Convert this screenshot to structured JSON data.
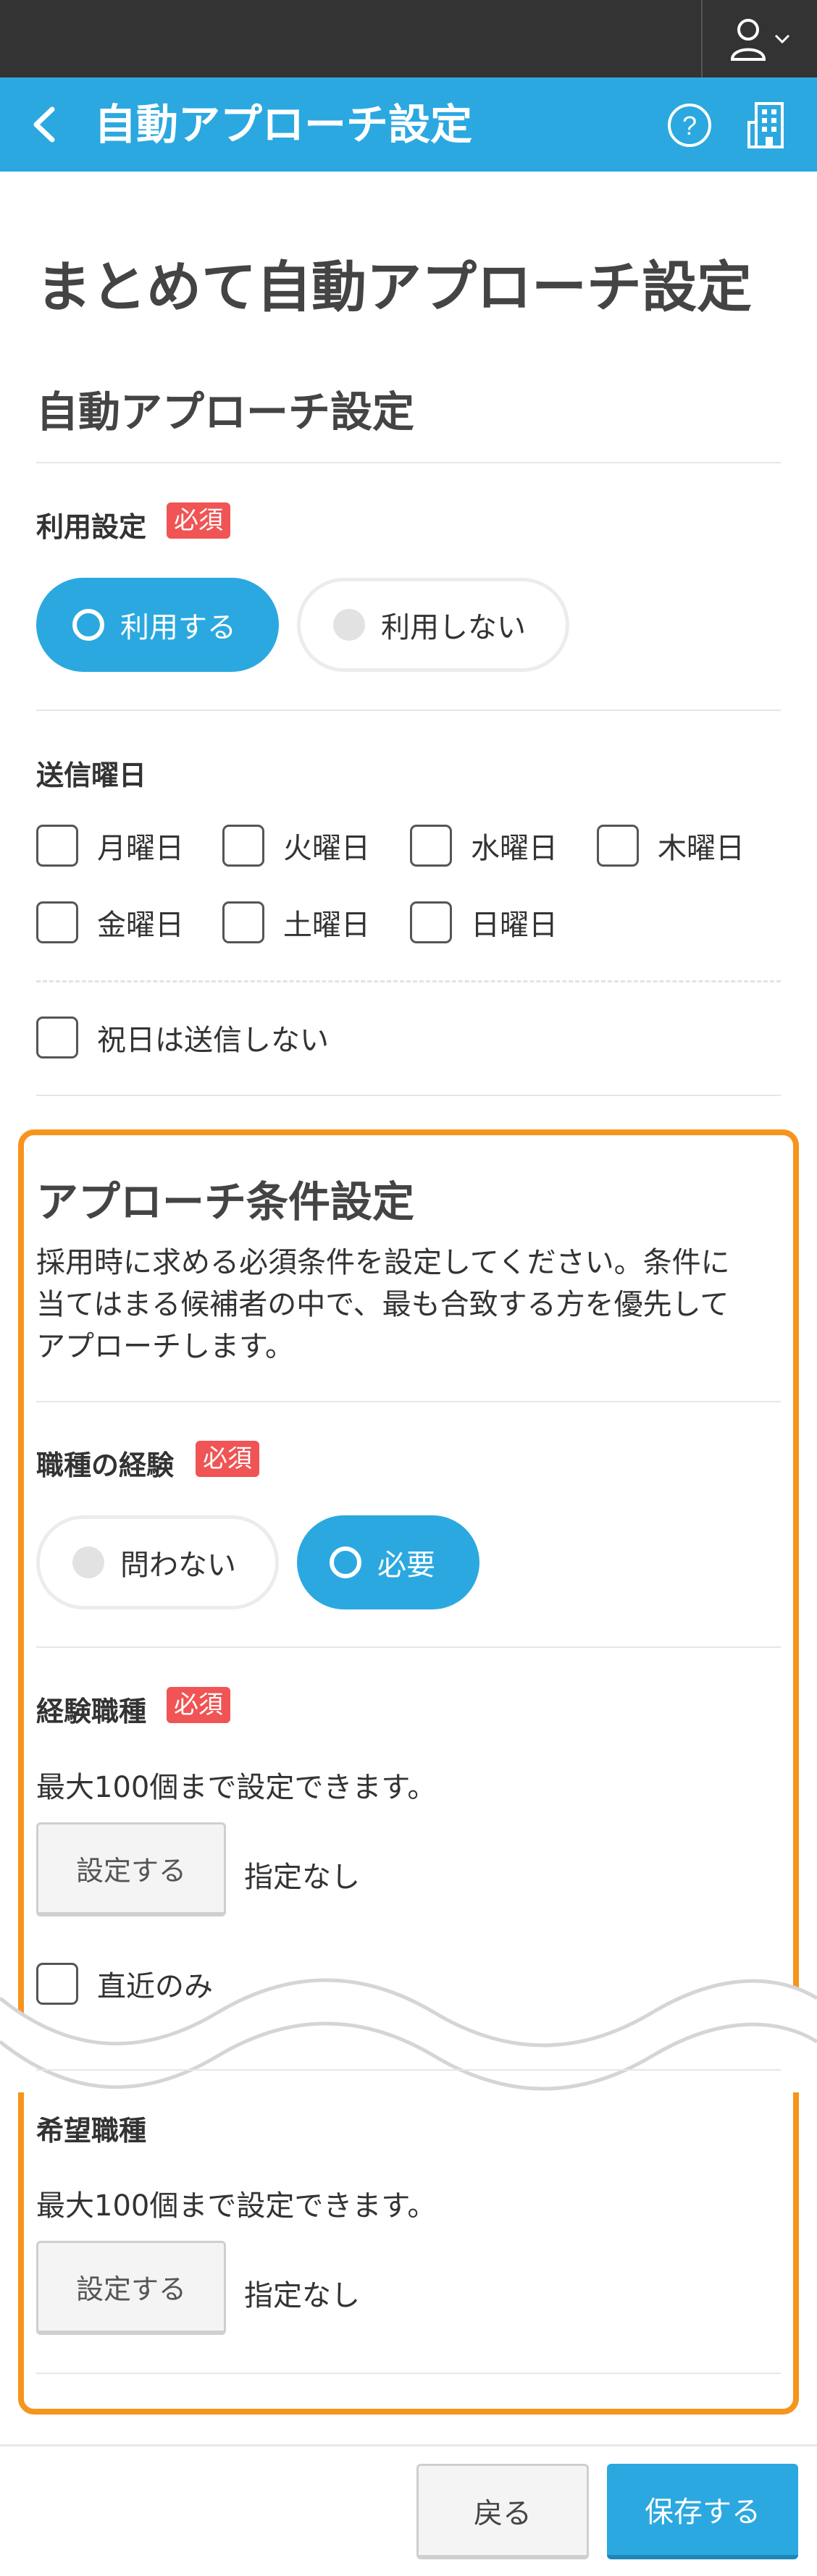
{
  "header": {
    "title": "自動アプローチ設定"
  },
  "page": {
    "title": "まとめて自動アプローチ設定",
    "section_title": "自動アプローチ設定"
  },
  "usage": {
    "label": "利用設定",
    "required": "必須",
    "options": [
      "利用する",
      "利用しない"
    ],
    "selected": "利用する"
  },
  "send_days": {
    "label": "送信曜日",
    "days": [
      "月曜日",
      "火曜日",
      "水曜日",
      "木曜日",
      "金曜日",
      "土曜日",
      "日曜日"
    ],
    "holiday": "祝日は送信しない"
  },
  "conditions": {
    "title": "アプローチ条件設定",
    "description": [
      "採用時に求める必須条件を設定してください。条件に",
      "当てはまる候補者の中で、最も合致する方を優先して",
      "アプローチします。"
    ],
    "experience": {
      "label": "職種の経験",
      "required": "必須",
      "options": [
        "問わない",
        "必要"
      ],
      "selected": "必要"
    },
    "experienced_jobs": {
      "label": "経験職種",
      "required": "必須",
      "note": "最大100個まで設定できます。",
      "button": "設定する",
      "value": "指定なし",
      "recent_only": "直近のみ"
    },
    "desired_jobs": {
      "label": "希望職種",
      "note": "最大100個まで設定できます。",
      "button": "設定する",
      "value": "指定なし"
    }
  },
  "footer": {
    "back": "戻る",
    "save": "保存する"
  },
  "colors": {
    "accent": "#2ba8e0",
    "required": "#f05454",
    "highlight": "#f7941d",
    "topbar": "#333333"
  }
}
